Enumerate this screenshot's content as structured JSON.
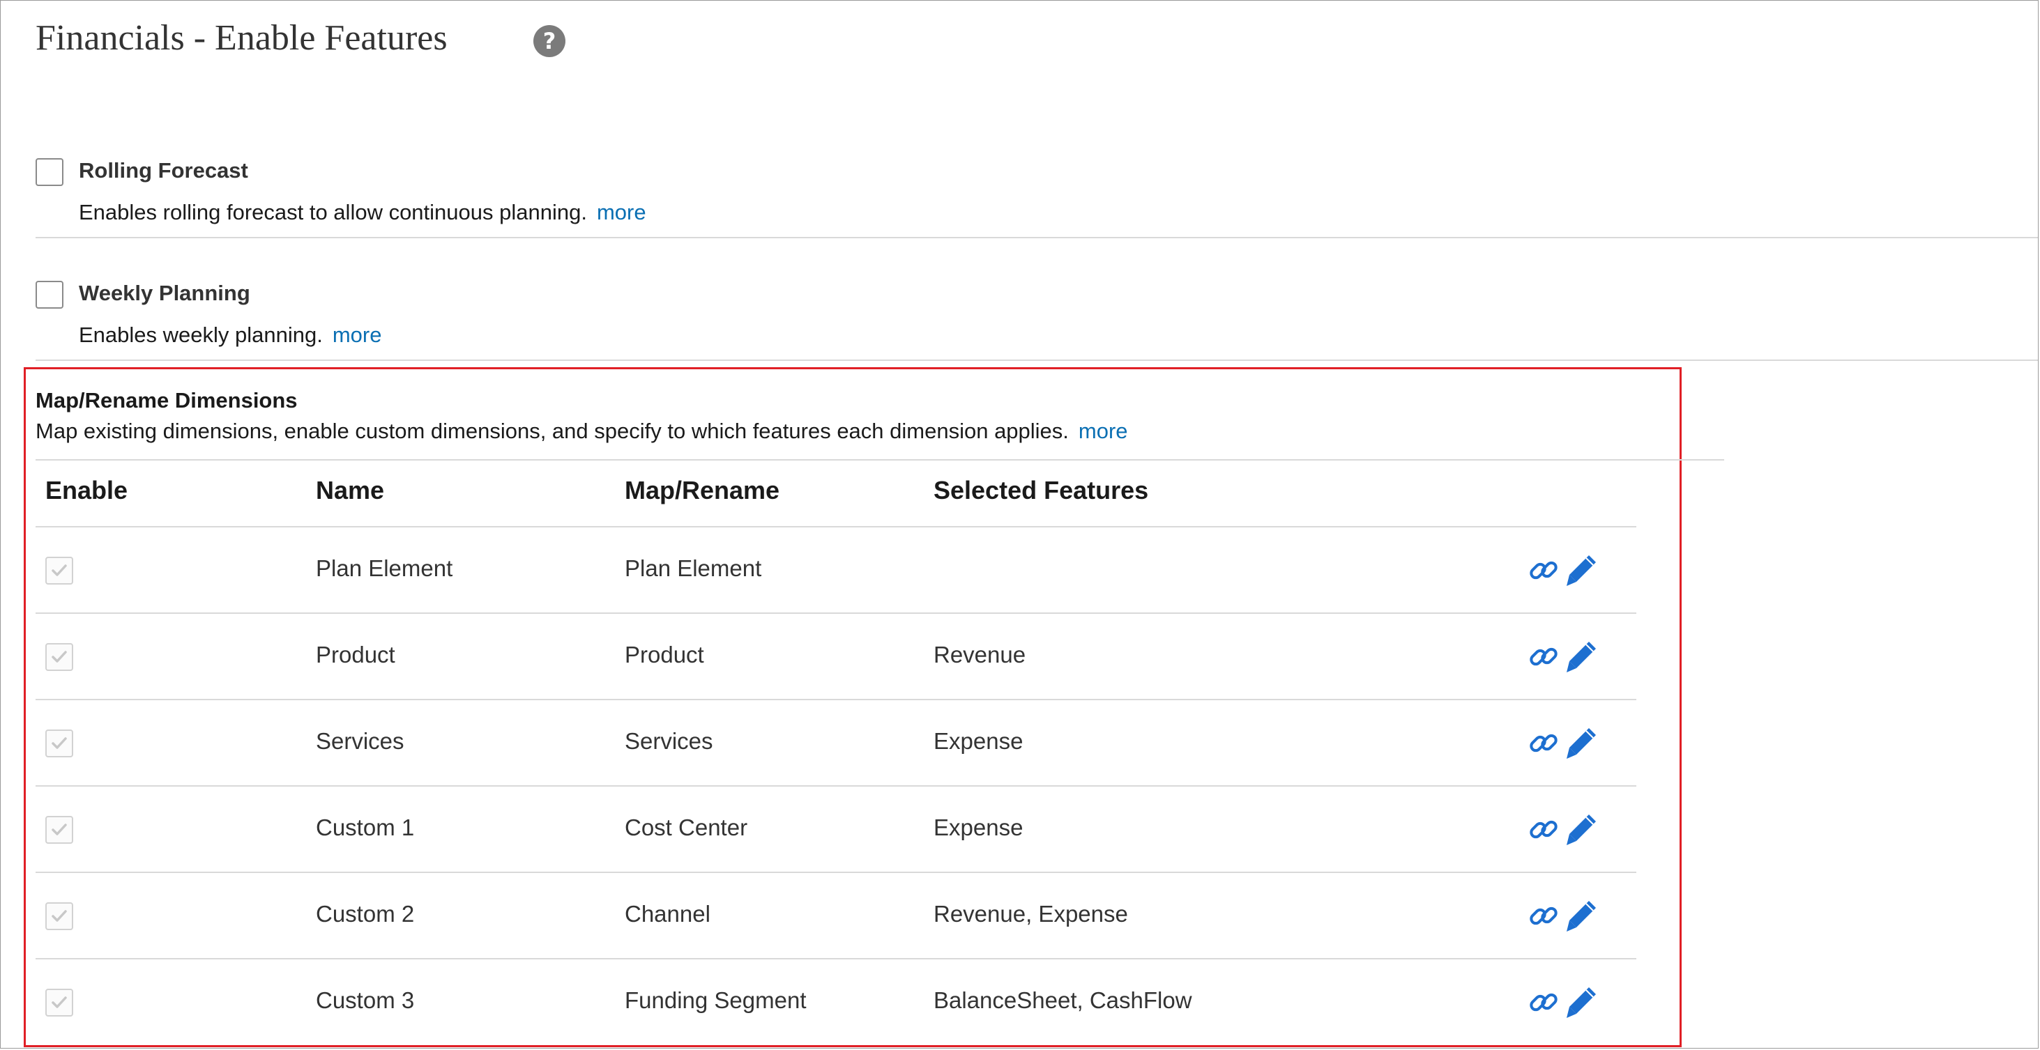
{
  "page": {
    "title": "Financials - Enable Features",
    "help_icon": "help-icon"
  },
  "features": [
    {
      "title": "Rolling Forecast",
      "description": "Enables rolling forecast to allow continuous planning.",
      "more": "more",
      "checked": false
    },
    {
      "title": "Weekly Planning",
      "description": "Enables weekly planning.",
      "more": "more",
      "checked": false
    }
  ],
  "map_rename": {
    "title": "Map/Rename Dimensions",
    "description": "Map existing dimensions, enable custom dimensions, and specify to which features each dimension applies.",
    "more": "more",
    "columns": {
      "enable": "Enable",
      "name": "Name",
      "map_rename": "Map/Rename",
      "selected_features": "Selected Features"
    },
    "rows": [
      {
        "name": "Plan Element",
        "map": "Plan Element",
        "features": ""
      },
      {
        "name": "Product",
        "map": "Product",
        "features": "Revenue"
      },
      {
        "name": "Services",
        "map": "Services",
        "features": "Expense"
      },
      {
        "name": "Custom 1",
        "map": "Cost Center",
        "features": "Expense"
      },
      {
        "name": "Custom 2",
        "map": "Channel",
        "features": "Revenue, Expense"
      },
      {
        "name": "Custom 3",
        "map": "Funding Segment",
        "features": "BalanceSheet, CashFlow"
      }
    ],
    "row_icons": [
      "link-icon",
      "pencil-icon"
    ]
  },
  "colors": {
    "link": "#0a6fb3",
    "highlight_border": "#e01f26",
    "icon_blue": "#1d6fd0"
  }
}
